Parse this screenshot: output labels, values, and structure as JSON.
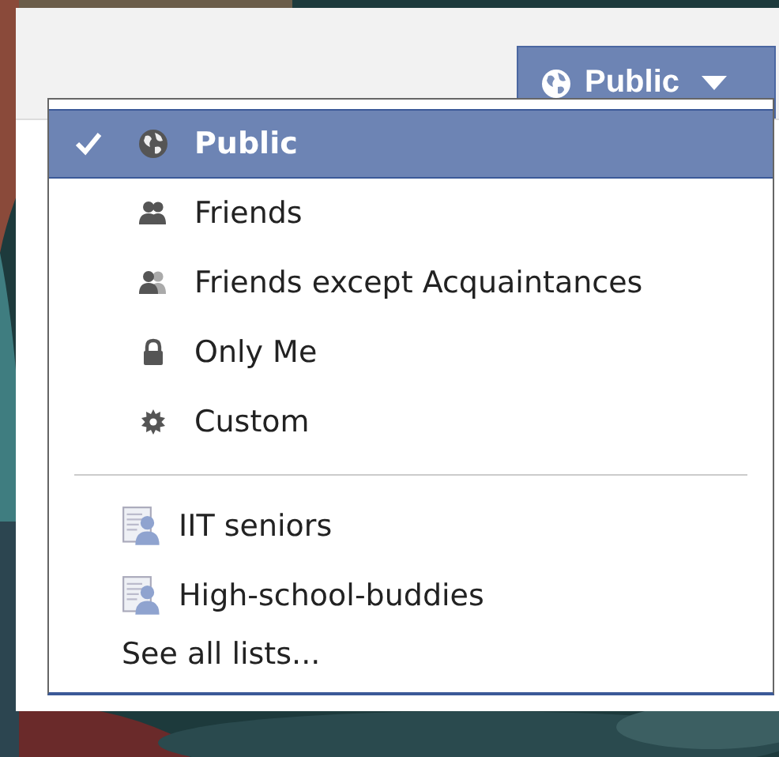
{
  "privacy_button": {
    "label": "Public",
    "kind": "globe"
  },
  "menu": {
    "options": [
      {
        "label": "Public",
        "kind": "globe",
        "selected": true
      },
      {
        "label": "Friends",
        "kind": "friends",
        "selected": false
      },
      {
        "label": "Friends except Acquaintances",
        "kind": "friends-except",
        "selected": false
      },
      {
        "label": "Only Me",
        "kind": "lock",
        "selected": false
      },
      {
        "label": "Custom",
        "kind": "gear",
        "selected": false
      }
    ],
    "lists": [
      {
        "label": "IIT seniors",
        "kind": "list",
        "selected": false
      },
      {
        "label": "High-school-buddies",
        "kind": "list",
        "selected": false
      }
    ],
    "see_all": "See all lists..."
  }
}
